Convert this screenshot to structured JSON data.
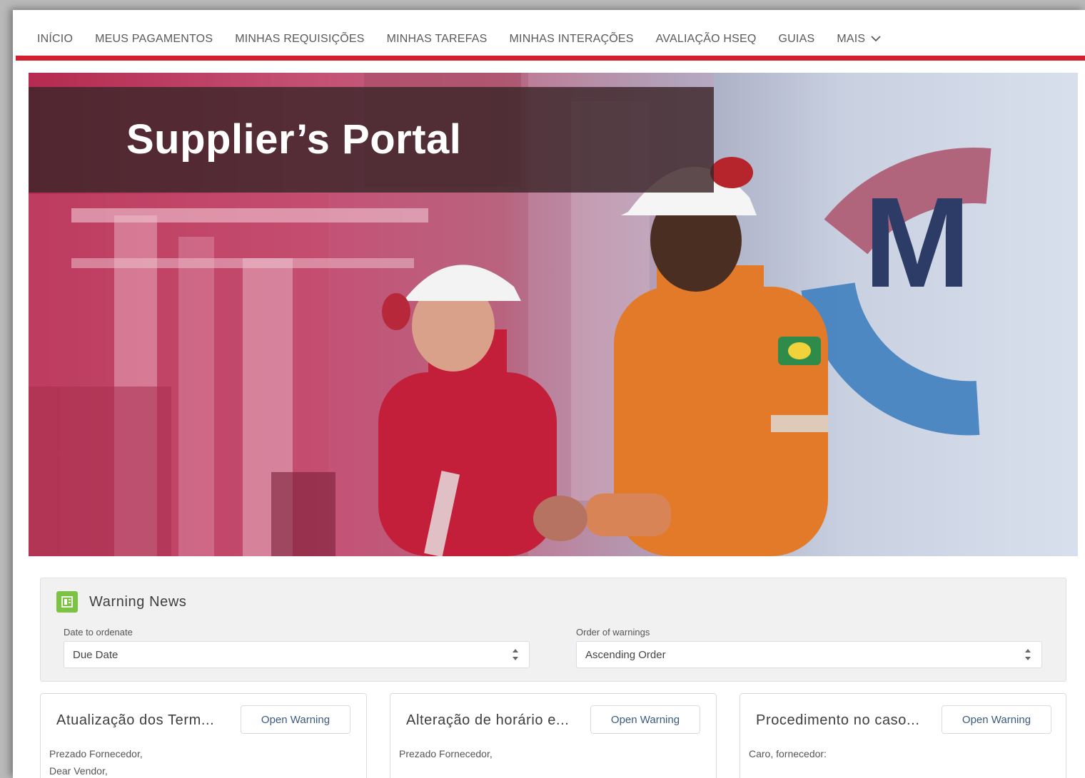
{
  "nav": {
    "items": [
      {
        "label": "INÍCIO"
      },
      {
        "label": "MEUS PAGAMENTOS"
      },
      {
        "label": "MINHAS REQUISIÇÕES"
      },
      {
        "label": "MINHAS TAREFAS"
      },
      {
        "label": "MINHAS INTERAÇÕES"
      },
      {
        "label": "AVALIAÇÃO HSEQ"
      },
      {
        "label": "GUIAS"
      }
    ],
    "more_label": "MAIS",
    "accent_color": "#d32031"
  },
  "hero": {
    "title": "Supplier’s Portal",
    "logo_letter": "M"
  },
  "warning_news": {
    "title": "Warning News",
    "date_label": "Date to ordenate",
    "date_value": "Due Date",
    "order_label": "Order of warnings",
    "order_value": "Ascending Order"
  },
  "cards": [
    {
      "title": "Atualização dos Term...",
      "button": "Open Warning",
      "line1": "Prezado Fornecedor,",
      "line2": "Dear Vendor,"
    },
    {
      "title": "Alteração de horário e...",
      "button": "Open Warning",
      "line1": "Prezado Fornecedor,",
      "line2": ""
    },
    {
      "title": "Procedimento no caso...",
      "button": "Open Warning",
      "line1": "Caro, fornecedor:",
      "line2": ""
    }
  ]
}
